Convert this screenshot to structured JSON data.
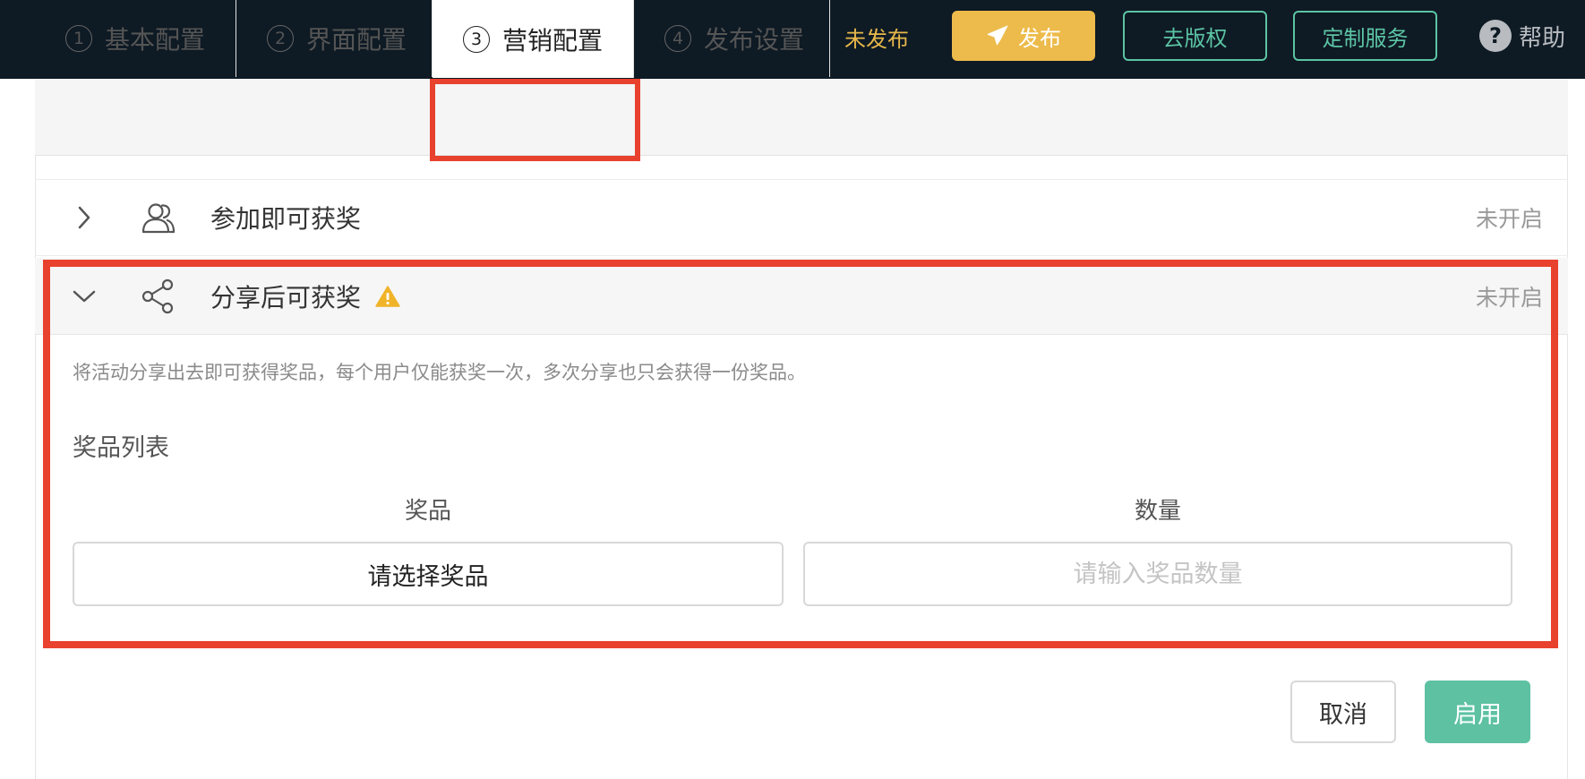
{
  "header": {
    "status": "未发布",
    "publish_label": "发布",
    "copyright_label": "去版权",
    "custom_service_label": "定制服务",
    "help_label": "帮助",
    "help_icon_glyph": "?"
  },
  "tabs": [
    {
      "num": "1",
      "label": "基本配置"
    },
    {
      "num": "2",
      "label": "界面配置"
    },
    {
      "num": "3",
      "label": "营销配置",
      "active": true
    },
    {
      "num": "4",
      "label": "发布设置"
    }
  ],
  "rows": [
    {
      "title": "参加即可获奖",
      "status": "未开启",
      "icon": "users-icon",
      "expanded": false
    },
    {
      "title": "分享后可获奖",
      "status": "未开启",
      "icon": "share-icon",
      "expanded": true,
      "warning": true
    }
  ],
  "panel": {
    "description": "将活动分享出去即可获得奖品，每个用户仅能获奖一次，多次分享也只会获得一份奖品。",
    "heading": "奖品列表",
    "col_prize": "奖品",
    "col_qty": "数量",
    "select_prize_label": "请选择奖品",
    "qty_placeholder": "请输入奖品数量",
    "qty_value": ""
  },
  "footer": {
    "cancel_label": "取消",
    "enable_label": "启用"
  },
  "colors": {
    "topbar_bg": "#0e1a24",
    "publish_btn": "#edbb4b",
    "accent_green": "#5cc4a4",
    "highlight_red": "#e8412e",
    "warning_yellow": "#f0b429"
  }
}
